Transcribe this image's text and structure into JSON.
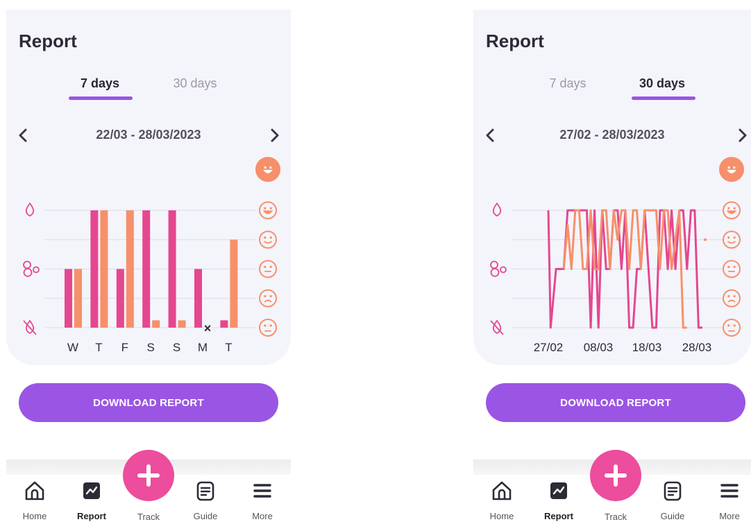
{
  "screens": [
    {
      "title": "Report",
      "tabs": [
        {
          "label": "7 days",
          "active": true
        },
        {
          "label": "30 days",
          "active": false
        }
      ],
      "date_range": "22/03 - 28/03/2023",
      "download_label": "DOWNLOAD REPORT",
      "nav": {
        "home": "Home",
        "report": "Report",
        "track": "Track",
        "guide": "Guide",
        "more": "More"
      }
    },
    {
      "title": "Report",
      "tabs": [
        {
          "label": "7 days",
          "active": false
        },
        {
          "label": "30 days",
          "active": true
        }
      ],
      "date_range": "27/02 - 28/03/2023",
      "download_label": "DOWNLOAD REPORT",
      "nav": {
        "home": "Home",
        "report": "Report",
        "track": "Track",
        "guide": "Guide",
        "more": "More"
      }
    }
  ],
  "colors": {
    "pink": "#e4478f",
    "orange": "#f6906a",
    "purple": "#9b55e4",
    "fab": "#ec4d9d"
  },
  "icons": {
    "left_axis": [
      "drop-icon",
      "bubbles-icon",
      "crossed-drop-icon"
    ],
    "right_axis": [
      "big-smile-icon",
      "smile-icon",
      "content-icon",
      "neutral-icon",
      "sad-icon",
      "very-sad-icon"
    ]
  },
  "chart_data": [
    {
      "type": "bar",
      "categories": [
        "W",
        "T",
        "F",
        "S",
        "S",
        "M",
        "T"
      ],
      "left_scale": [
        0,
        4
      ],
      "right_scale": [
        0,
        4
      ],
      "series": [
        {
          "values": [
            2,
            4,
            2,
            4,
            4,
            2,
            0.25
          ],
          "color": "#e4478f"
        },
        {
          "values": [
            2,
            4,
            4,
            0.25,
            0.25,
            null,
            3
          ],
          "color": "#f6906a"
        }
      ],
      "missing_marker": {
        "category_index": 5,
        "symbol": "×"
      }
    },
    {
      "type": "line",
      "x_ticks": [
        "27/02",
        "08/03",
        "18/03",
        "28/03"
      ],
      "x_range": [
        0,
        29
      ],
      "y_range": [
        0,
        4
      ],
      "series": [
        {
          "color": "#e4478f",
          "points": [
            [
              0,
              4
            ],
            [
              0.3,
              0
            ],
            [
              1,
              2
            ],
            [
              1.5,
              2
            ],
            [
              2,
              2
            ],
            [
              2.5,
              4
            ],
            [
              3,
              4
            ],
            [
              4,
              4
            ],
            [
              4.5,
              4
            ],
            [
              5,
              4
            ],
            [
              5.5,
              0
            ],
            [
              6,
              4
            ],
            [
              6.5,
              0
            ],
            [
              7,
              4
            ],
            [
              7.5,
              2
            ],
            [
              8,
              2
            ],
            [
              8.5,
              4
            ],
            [
              9,
              4
            ],
            [
              9.5,
              2
            ],
            [
              10,
              4
            ],
            [
              10.5,
              0
            ],
            [
              11,
              0
            ],
            [
              11.5,
              2
            ],
            [
              12,
              2
            ],
            [
              12.5,
              4
            ],
            [
              13,
              2
            ],
            [
              13.5,
              0
            ],
            [
              14,
              0
            ],
            [
              14.5,
              4
            ],
            [
              15,
              4
            ],
            [
              15.5,
              2
            ],
            [
              16,
              4
            ],
            [
              16.5,
              2
            ],
            [
              17,
              4
            ],
            [
              17.5,
              4
            ],
            [
              18,
              2
            ],
            [
              18.5,
              4
            ],
            [
              19,
              4
            ],
            [
              19.5,
              0
            ],
            [
              20,
              0
            ]
          ]
        },
        {
          "color": "#f6906a",
          "points": [
            [
              2,
              2
            ],
            [
              2.5,
              3.5
            ],
            [
              3,
              2
            ],
            [
              3.5,
              4
            ],
            [
              4,
              4
            ],
            [
              4.5,
              2
            ],
            [
              5,
              2
            ],
            [
              5.5,
              4
            ],
            [
              6,
              2
            ],
            [
              6.5,
              2
            ],
            [
              7,
              4
            ],
            [
              7.5,
              4
            ],
            [
              8,
              2
            ],
            [
              8.5,
              4
            ],
            [
              9,
              3
            ],
            [
              9.5,
              4
            ],
            [
              10,
              4
            ],
            [
              10.5,
              2
            ],
            [
              11,
              4
            ],
            [
              11.5,
              4
            ],
            [
              12,
              2
            ],
            [
              12.5,
              4
            ],
            [
              13,
              4
            ],
            [
              13.5,
              4
            ],
            [
              14,
              4
            ],
            [
              14.5,
              2
            ],
            [
              15,
              4
            ],
            [
              15.5,
              4
            ],
            [
              16,
              2
            ],
            [
              16.5,
              3
            ],
            [
              17,
              4
            ],
            [
              17.5,
              0
            ],
            [
              18,
              0
            ]
          ]
        }
      ],
      "stray_point": {
        "x": 20,
        "y": 3
      }
    }
  ]
}
